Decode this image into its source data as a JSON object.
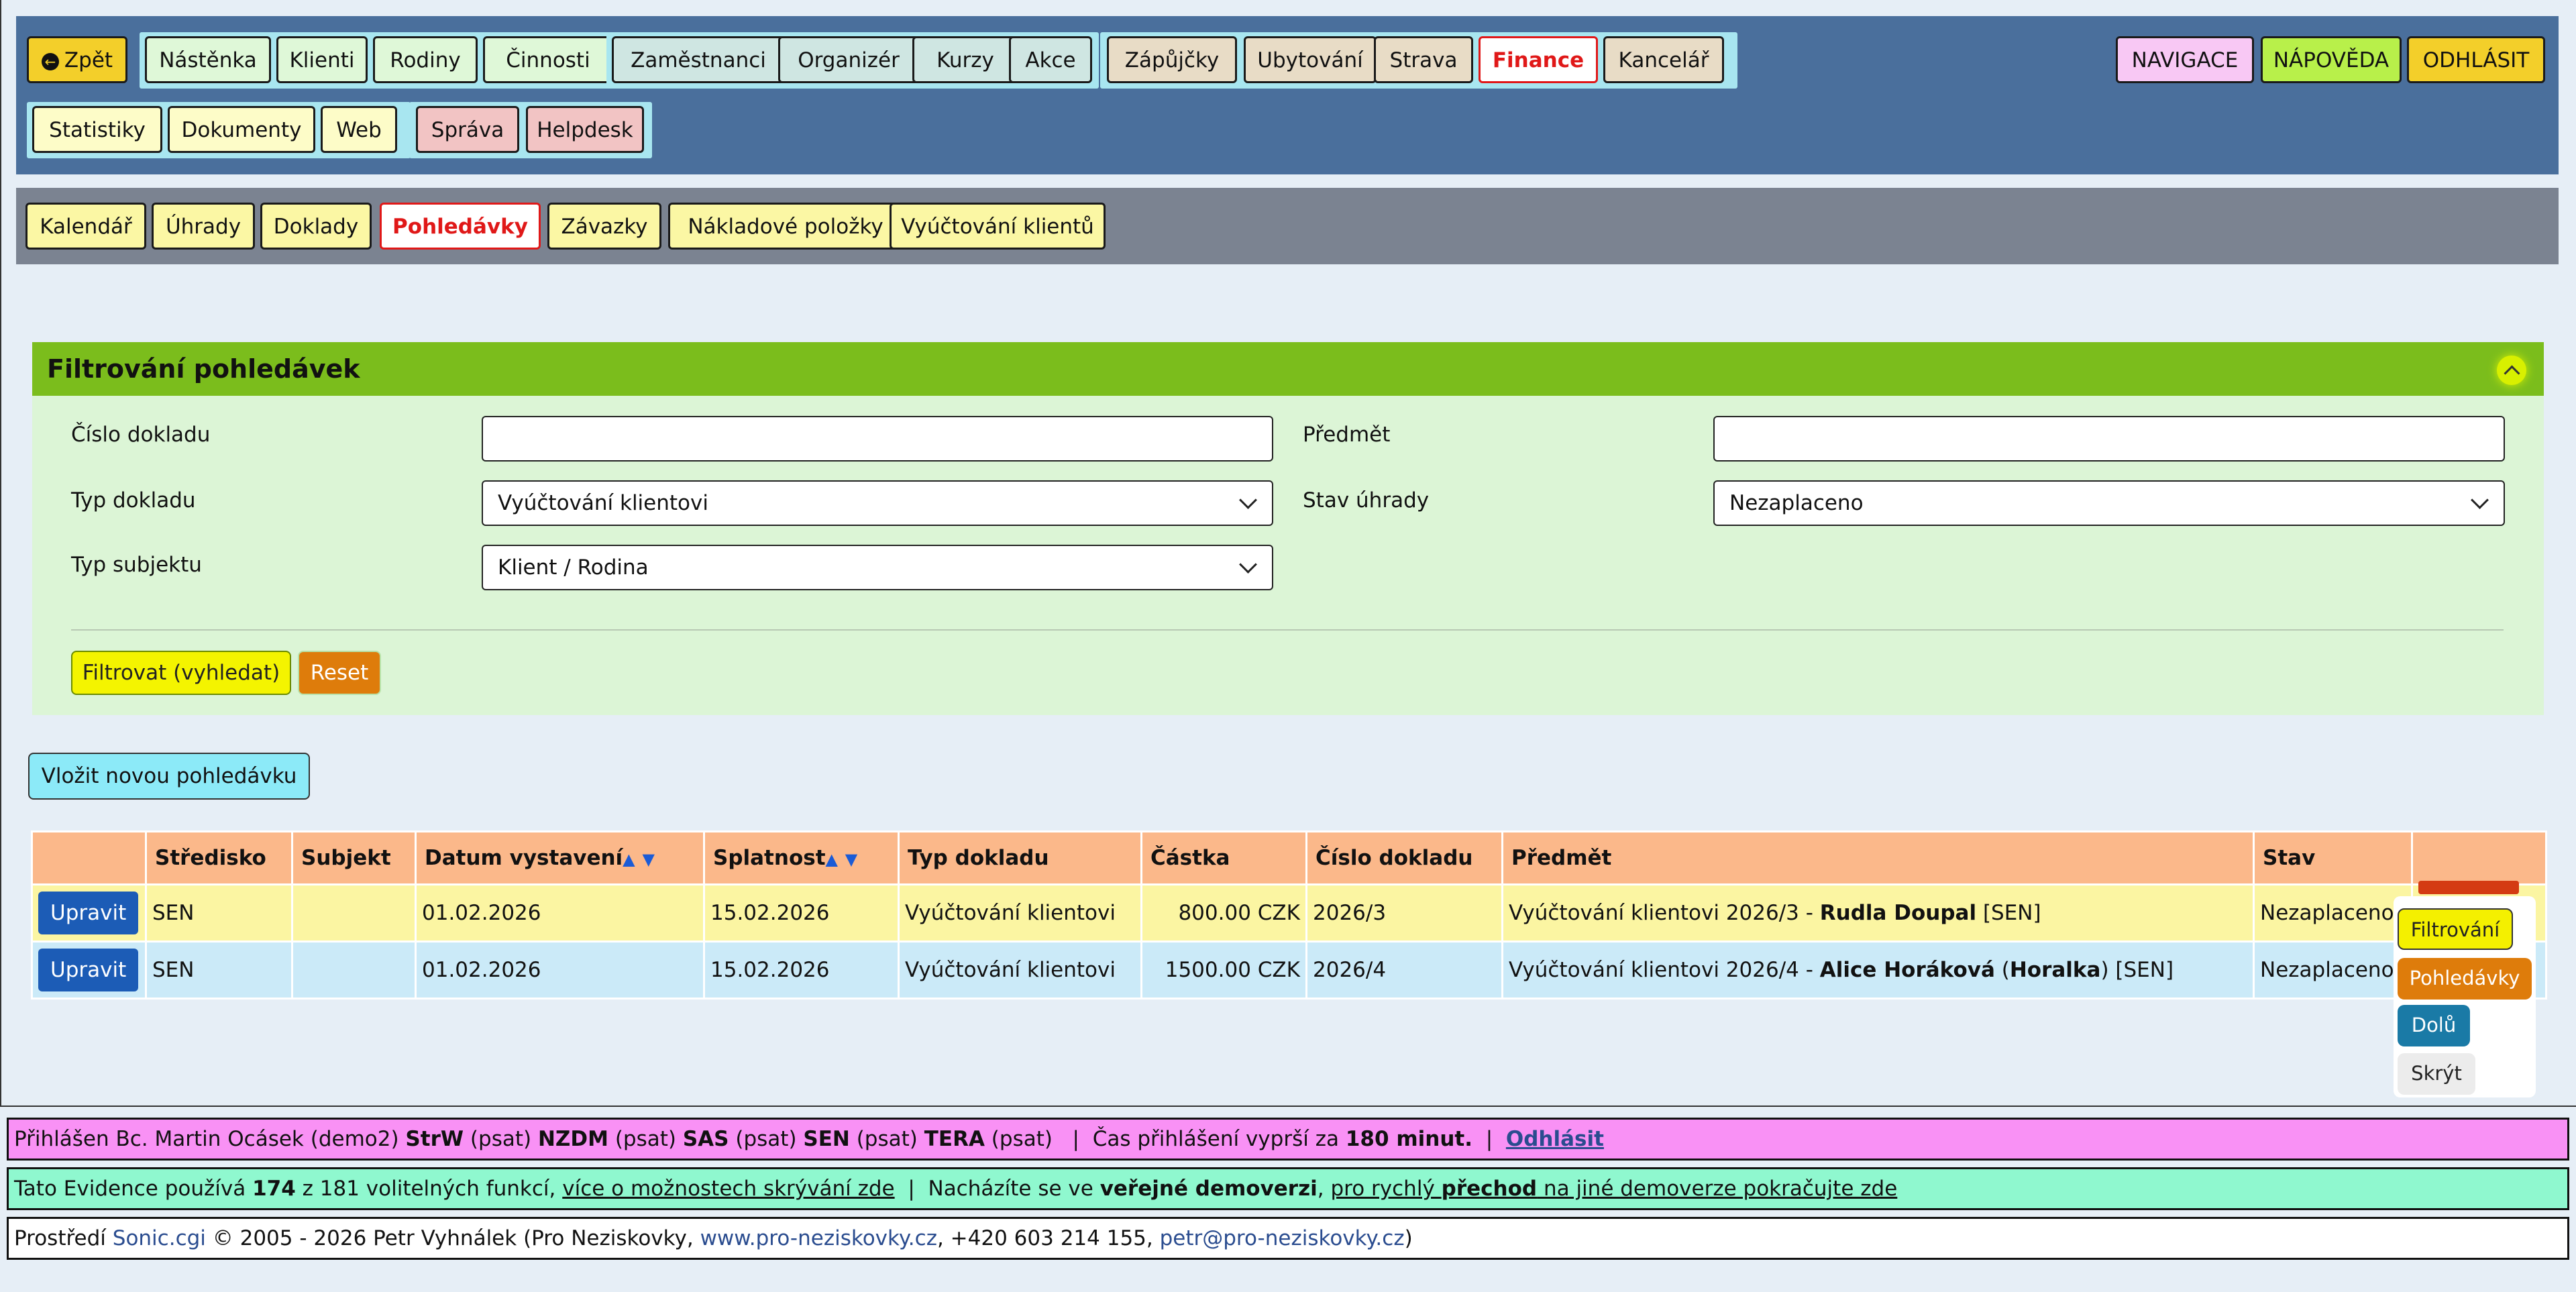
{
  "topnav": {
    "back": "Zpět",
    "group1": [
      "Nástěnka",
      "Klienti",
      "Rodiny",
      "Činnosti"
    ],
    "group2": [
      "Zaměstnanci",
      "Organizér",
      "Kurzy",
      "Akce"
    ],
    "group3": [
      "Zápůjčky",
      "Ubytování",
      "Strava",
      "Finance",
      "Kancelář"
    ],
    "group4": [
      "Statistiky",
      "Dokumenty",
      "Web"
    ],
    "group5": [
      "Správa",
      "Helpdesk"
    ],
    "right": [
      "NAVIGACE",
      "NÁPOVĚDA",
      "ODHLÁSIT"
    ]
  },
  "subnav": [
    "Kalendář",
    "Úhrady",
    "Doklady",
    "Pohledávky",
    "Závazky",
    "Nákladové položky",
    "Vyúčtování klientů"
  ],
  "filter": {
    "title": "Filtrování pohledávek",
    "cislo_label": "Číslo dokladu",
    "cislo_value": "",
    "predmet_label": "Předmět",
    "predmet_value": "",
    "typ_label": "Typ dokladu",
    "typ_value": "Vyúčtování klientovi",
    "stav_label": "Stav úhrady",
    "stav_value": "Nezaplaceno",
    "subjekt_label": "Typ subjektu",
    "subjekt_value": "Klient / Rodina",
    "submit": "Filtrovat (vyhledat)",
    "reset": "Reset"
  },
  "new_button": "Vložit novou pohledávku",
  "table": {
    "headers": [
      "",
      "Středisko",
      "Subjekt",
      "Datum vystavení",
      "Splatnost",
      "Typ dokladu",
      "Částka",
      "Číslo dokladu",
      "Předmět",
      "Stav",
      ""
    ],
    "edit_label": "Upravit",
    "rows": [
      {
        "stredisko": "SEN",
        "subjekt": "",
        "datum": "01.02.2026",
        "splatnost": "15.02.2026",
        "typ": "Vyúčtování klientovi",
        "castka": "800.00 CZK",
        "cislo": "2026/3",
        "predmet_prefix": "Vyúčtování klientovi 2026/3 - ",
        "predmet_name": "Rudla Doupal",
        "predmet_suffix": " [SEN]",
        "stav": "Nezaplaceno"
      },
      {
        "stredisko": "SEN",
        "subjekt": "",
        "datum": "01.02.2026",
        "splatnost": "15.02.2026",
        "typ": "Vyúčtování klientovi",
        "castka": "1500.00 CZK",
        "cislo": "2026/4",
        "predmet_prefix": "Vyúčtování klientovi 2026/4 - ",
        "predmet_name": "Alice Horáková",
        "predmet_mid": " (",
        "predmet_nick": "Horalka",
        "predmet_suffix": ") [SEN]",
        "stav": "Nezaplaceno"
      }
    ]
  },
  "float_panel": [
    "Filtrování",
    "Pohledávky",
    "Dolů",
    "Skrýt"
  ],
  "footer": {
    "login_prefix": "Přihlášen Bc. Martin Ocásek (demo2) ",
    "login_units": [
      {
        "code": "StrW",
        "role": " (psat) "
      },
      {
        "code": "NZDM",
        "role": " (psat) "
      },
      {
        "code": "SAS",
        "role": " (psat) "
      },
      {
        "code": "SEN",
        "role": " (psat) "
      },
      {
        "code": "TERA",
        "role": " (psat) "
      }
    ],
    "timeout_prefix": "  |  Čas přihlášení vyprší za ",
    "timeout_value": "180 minut.",
    "sep": "  |  ",
    "logout_link": "Odhlásit",
    "info_prefix": "Tato Evidence používá ",
    "info_count": "174",
    "info_mid": " z 181 volitelných funkcí, ",
    "info_link": "více o možnostech skrývání zde",
    "info_sep": "  |  Nacházíte se ve ",
    "info_demo": "veřejné demoverzi",
    "info_link2_a": "pro rychlý ",
    "info_link2_b": "přechod",
    "info_link2_c": " na jiné demoverze pokračujte zde",
    "copy_prefix": "Prostředí ",
    "copy_sonic": "Sonic.cgi",
    "copy_mid": " © 2005 - 2026 Petr Vyhnálek (Pro Neziskovky, ",
    "copy_web": "www.pro-neziskovky.cz",
    "copy_phone": ", +420 603 214 155, ",
    "copy_mail": "petr@pro-neziskovky.cz",
    "copy_end": ")"
  },
  "colors": {
    "nav_bg": "#4a6f9c",
    "filter_header": "#7bbd1c",
    "active": "#e01818",
    "edit_btn": "#1c5cb6"
  }
}
